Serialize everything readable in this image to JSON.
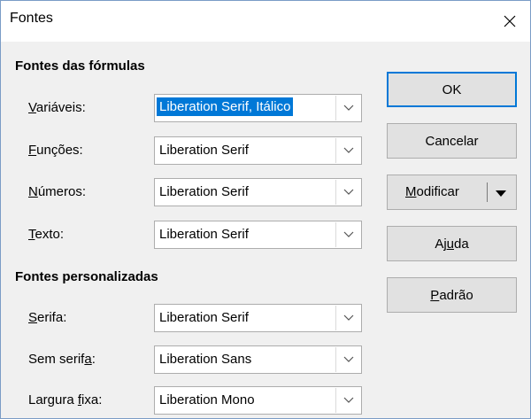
{
  "window": {
    "title": "Fontes"
  },
  "sections": {
    "formula_fonts": "Fontes das fórmulas",
    "custom_fonts": "Fontes personalizadas"
  },
  "rows": {
    "variables": {
      "label_pre": "",
      "label_key": "V",
      "label_post": "ariáveis:",
      "value": "Liberation Serif, Itálico"
    },
    "functions": {
      "label_pre": "",
      "label_key": "F",
      "label_post": "unções:",
      "value": "Liberation Serif"
    },
    "numbers": {
      "label_pre": "",
      "label_key": "N",
      "label_post": "úmeros:",
      "value": "Liberation Serif"
    },
    "text": {
      "label_pre": "",
      "label_key": "T",
      "label_post": "exto:",
      "value": "Liberation Serif"
    },
    "serif": {
      "label_pre": "",
      "label_key": "S",
      "label_post": "erifa:",
      "value": "Liberation Serif"
    },
    "sans": {
      "label_pre": "Sem serif",
      "label_key": "a",
      "label_post": ":",
      "value": "Liberation Sans"
    },
    "mono": {
      "label_pre": "Largura ",
      "label_key": "f",
      "label_post": "ixa:",
      "value": "Liberation Mono"
    }
  },
  "buttons": {
    "ok": "OK",
    "cancel": "Cancelar",
    "modify": {
      "pre": "",
      "key": "M",
      "post": "odificar"
    },
    "help": {
      "pre": "Aj",
      "key": "u",
      "post": "da"
    },
    "default": {
      "pre": "",
      "key": "P",
      "post": "adrão"
    }
  },
  "icons": {
    "close": "close-icon",
    "dropdown": "chevron-down-icon",
    "split_arrow": "triangle-down-icon"
  },
  "colors": {
    "highlight": "#0078d7",
    "border": "#7a9cc6",
    "button_face": "#e1e1e1"
  }
}
